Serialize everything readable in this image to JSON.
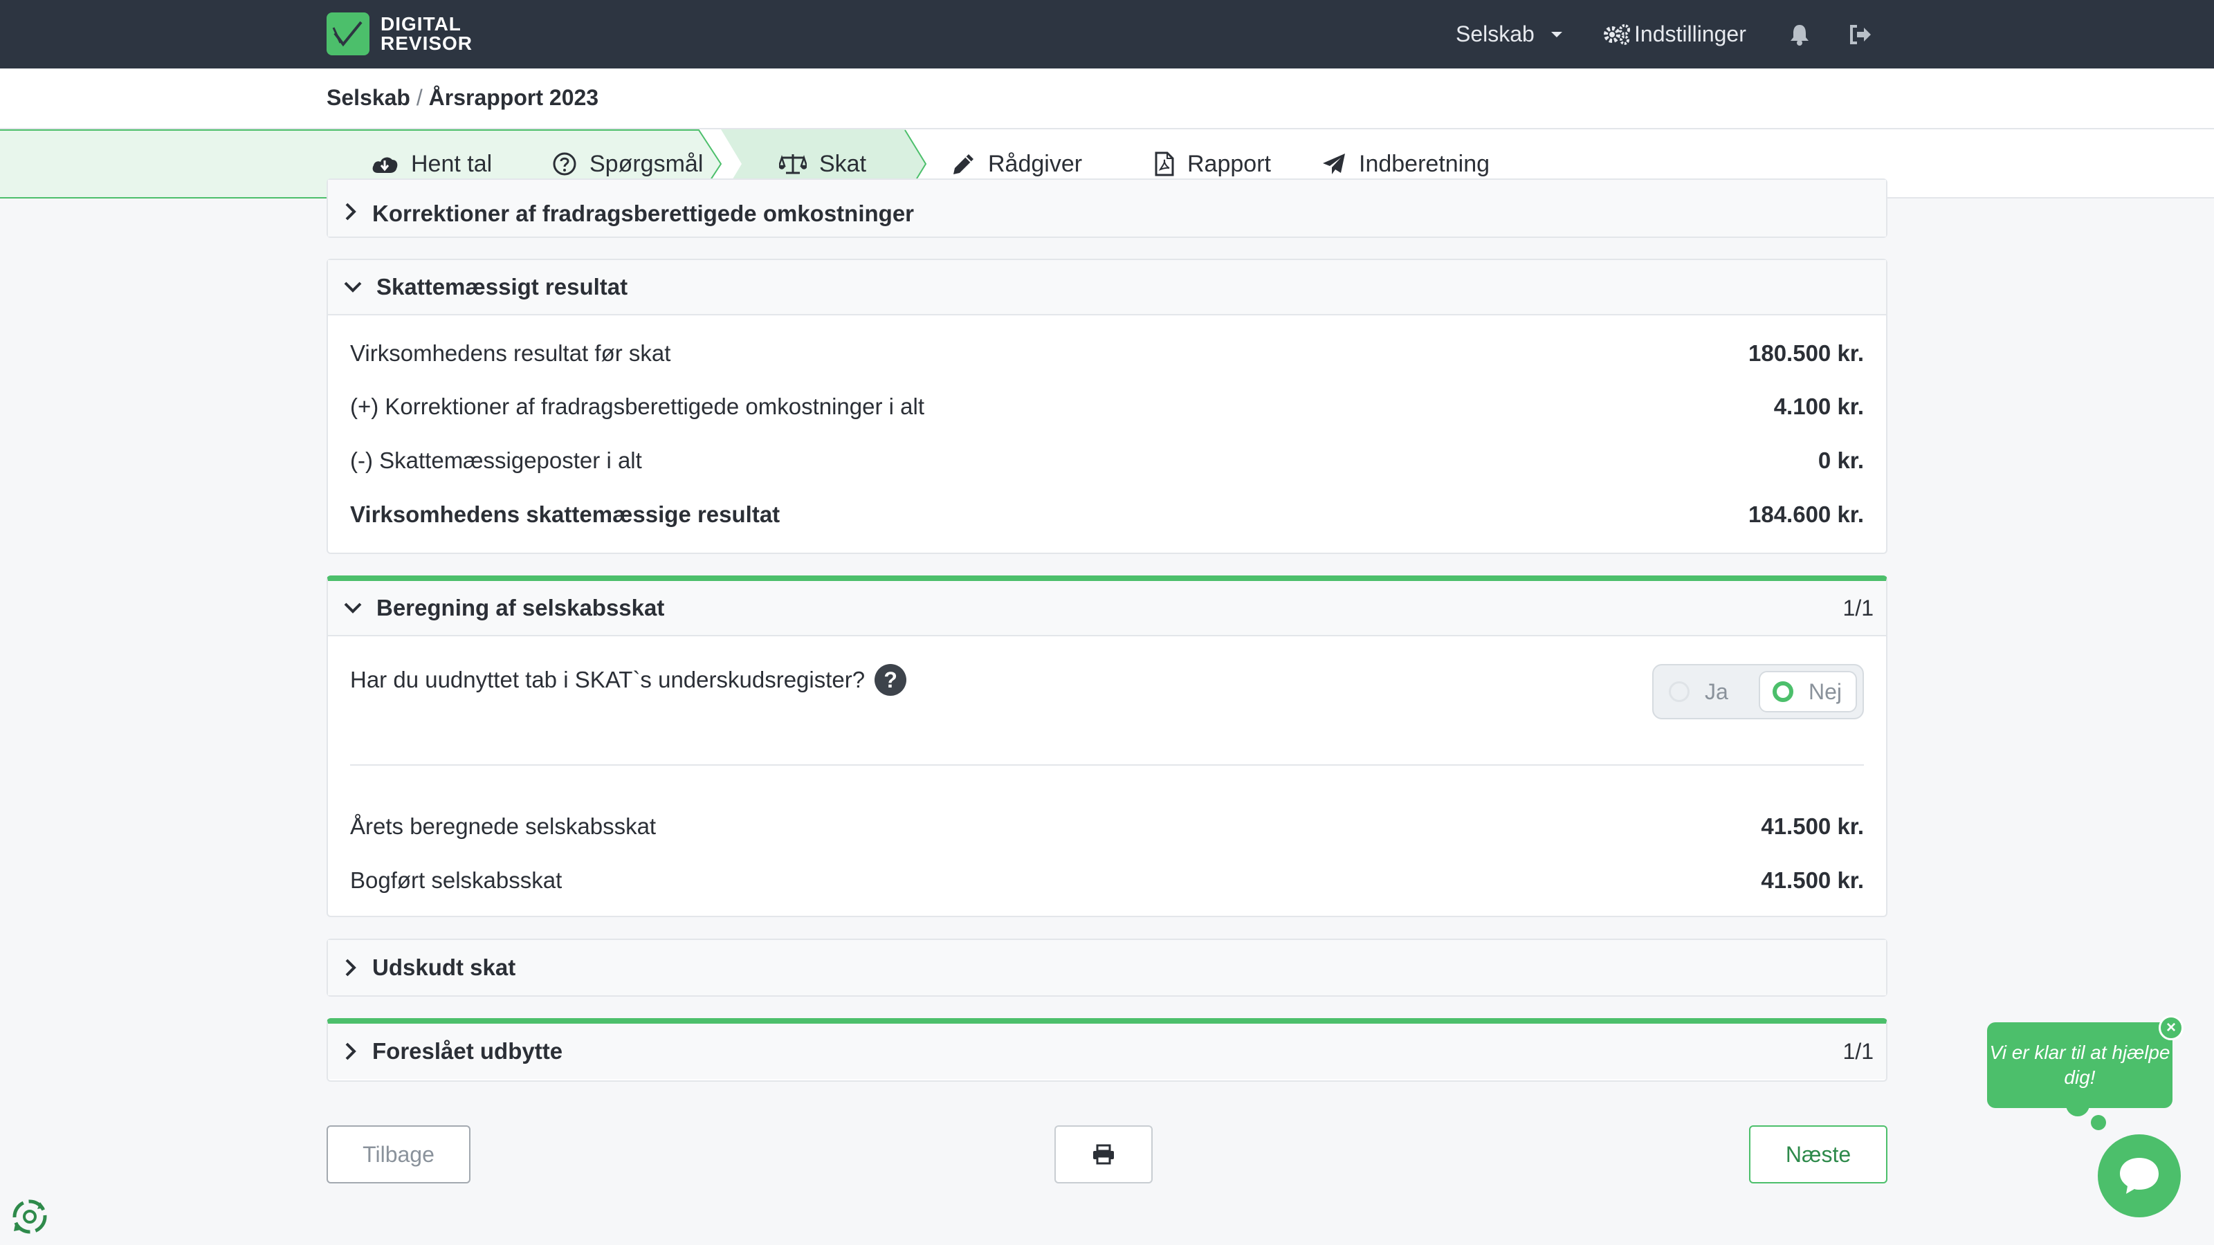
{
  "brand": {
    "line1": "DIGITAL",
    "line2": "REVISOR",
    "accent": "#4cbf6b",
    "navbar_bg": "#2d3541"
  },
  "nav": {
    "company": "Selskab",
    "settings": "Indstillinger"
  },
  "breadcrumb": {
    "parent": "Selskab",
    "separator": "/",
    "current": "Årsrapport 2023"
  },
  "steps": [
    {
      "label": "Hent tal",
      "icon": "cloud-download-icon"
    },
    {
      "label": "Spørgsmål",
      "icon": "question-circle-icon"
    },
    {
      "label": "Skat",
      "icon": "balance-scale-icon"
    },
    {
      "label": "Rådgiver",
      "icon": "pencil-icon"
    },
    {
      "label": "Rapport",
      "icon": "file-pdf-icon"
    },
    {
      "label": "Indberetning",
      "icon": "paper-plane-icon"
    }
  ],
  "sections": {
    "corrections": {
      "title": "Korrektioner af fradragsberettigede omkostninger"
    },
    "tax_result": {
      "title": "Skattemæssigt resultat",
      "rows": [
        {
          "label": "Virksomhedens resultat før skat",
          "value": "180.500 kr."
        },
        {
          "label": "(+) Korrektioner af fradragsberettigede omkostninger i alt",
          "value": "4.100 kr."
        },
        {
          "label": "(-) Skattemæssigeposter i alt",
          "value": "0 kr."
        },
        {
          "label": "Virksomhedens skattemæssige resultat",
          "value": "184.600 kr."
        }
      ]
    },
    "corporate_tax": {
      "title": "Beregning af selskabsskat",
      "count": "1/1",
      "question": "Har du uudnyttet tab i SKAT`s underskudsregister?",
      "options": {
        "yes": "Ja",
        "no": "Nej",
        "selected": "Nej"
      },
      "rows": [
        {
          "label": "Årets beregnede selskabsskat",
          "value": "41.500 kr."
        },
        {
          "label": "Bogført selskabsskat",
          "value": "41.500 kr."
        }
      ]
    },
    "deferred_tax": {
      "title": "Udskudt skat"
    },
    "dividend": {
      "title": "Foreslået udbytte",
      "count": "1/1"
    }
  },
  "buttons": {
    "back": "Tilbage",
    "next": "Næste"
  },
  "chat": {
    "message": "Vi er klar til at hjælpe dig!",
    "close": "×"
  }
}
